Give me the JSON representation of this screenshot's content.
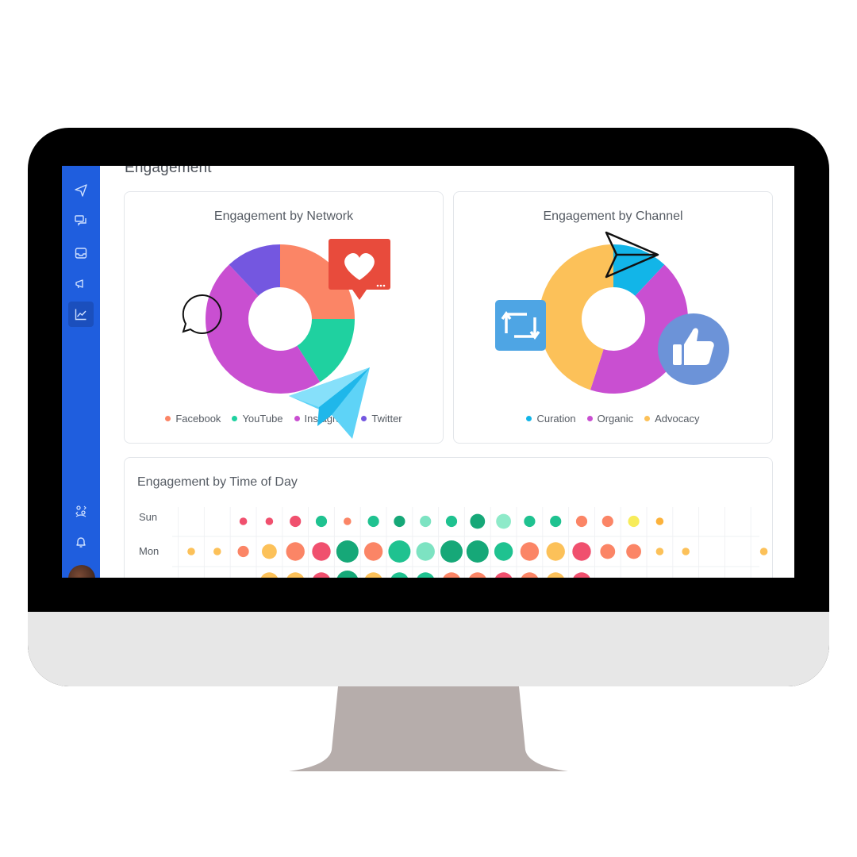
{
  "page": {
    "title": "Engagement"
  },
  "colors": {
    "sidebar": "#1f5ede",
    "facebook": "#fb8566",
    "youtube": "#1fd1a0",
    "instagram": "#c94fd1",
    "twitter": "#7457e0",
    "curation": "#12b5e8",
    "organic": "#c94fd1",
    "advocacy": "#fcc159"
  },
  "sidebar": {
    "items": [
      {
        "icon": "paper-plane-icon"
      },
      {
        "icon": "chat-bubbles-icon"
      },
      {
        "icon": "inbox-icon"
      },
      {
        "icon": "megaphone-icon"
      },
      {
        "icon": "analytics-chart-icon",
        "active": true
      }
    ],
    "bottom": [
      {
        "icon": "switch-user-icon"
      },
      {
        "icon": "bell-icon"
      }
    ]
  },
  "network_card": {
    "title": "Engagement by Network",
    "legend": [
      {
        "label": "Facebook",
        "color": "#fb8566"
      },
      {
        "label": "YouTube",
        "color": "#1fd1a0"
      },
      {
        "label": "Instagram",
        "color": "#c94fd1"
      },
      {
        "label": "Twitter",
        "color": "#7457e0"
      }
    ]
  },
  "channel_card": {
    "title": "Engagement by Channel",
    "legend": [
      {
        "label": "Curation",
        "color": "#12b5e8"
      },
      {
        "label": "Organic",
        "color": "#c94fd1"
      },
      {
        "label": "Advocacy",
        "color": "#fcc159"
      }
    ]
  },
  "time_card": {
    "title": "Engagement by Time of Day",
    "rows": [
      "Sun",
      "Mon"
    ]
  },
  "chart_data": [
    {
      "type": "pie",
      "title": "Engagement by Network",
      "labels": [
        "Facebook",
        "YouTube",
        "Instagram",
        "Twitter"
      ],
      "values": [
        25,
        16,
        47,
        12
      ],
      "colors": [
        "#fb8566",
        "#1fd1a0",
        "#c94fd1",
        "#7457e0"
      ],
      "donut": true
    },
    {
      "type": "pie",
      "title": "Engagement by Channel",
      "labels": [
        "Curation",
        "Organic",
        "Advocacy"
      ],
      "values": [
        12,
        43,
        45
      ],
      "colors": [
        "#12b5e8",
        "#c94fd1",
        "#fcc159"
      ],
      "donut": true
    },
    {
      "type": "heatmap",
      "title": "Engagement by Time of Day",
      "rows": [
        "Sun",
        "Mon",
        ""
      ],
      "series": [
        {
          "row": "Sun",
          "values": [
            0,
            0,
            1,
            1,
            2,
            2,
            1,
            2,
            2,
            2,
            2,
            3,
            3,
            2,
            2,
            2,
            2,
            2,
            1,
            0,
            0,
            0,
            0
          ],
          "colors": [
            "",
            "",
            "#f0506e",
            "#f0506e",
            "#f0506e",
            "#1fc290",
            "#fb8566",
            "#1fc290",
            "#16a878",
            "#7de3c2",
            "#1fc290",
            "#16a878",
            "#8eeac9",
            "#1fc290",
            "#1fc290",
            "#fb8566",
            "#fb8566",
            "#f7ec5a",
            "#fcb23b",
            "#fcc159",
            "",
            "",
            ""
          ]
        },
        {
          "row": "Mon",
          "values": [
            1,
            1,
            2,
            3,
            4,
            4,
            5,
            4,
            5,
            4,
            5,
            5,
            4,
            4,
            4,
            4,
            3,
            3,
            1,
            1,
            0,
            0,
            1
          ],
          "colors": [
            "#fcc159",
            "#fcc159",
            "#fb8566",
            "#fcc159",
            "#fb8566",
            "#f0506e",
            "#16a878",
            "#fb8566",
            "#1fc290",
            "#7de3c2",
            "#16a878",
            "#16a878",
            "#1fc290",
            "#fb8566",
            "#fcc159",
            "#f0506e",
            "#fb8566",
            "#fb8566",
            "#fcc159",
            "#fcc159",
            "",
            "",
            "#fcc159"
          ]
        },
        {
          "row": "",
          "values": [
            0,
            0,
            0,
            4,
            4,
            4,
            5,
            4,
            4,
            4,
            4,
            4,
            4,
            4,
            4,
            4,
            0,
            0,
            0,
            0,
            0,
            0,
            0
          ],
          "colors": [
            "",
            "",
            "",
            "#fcc159",
            "#fcc159",
            "#f0506e",
            "#16a878",
            "#fcc159",
            "#1fc290",
            "#1fc290",
            "#fb8566",
            "#fb8566",
            "#f0506e",
            "#fb8566",
            "#fcc159",
            "#f0506e",
            "",
            "",
            "",
            "",
            "",
            "",
            ""
          ]
        }
      ]
    }
  ]
}
